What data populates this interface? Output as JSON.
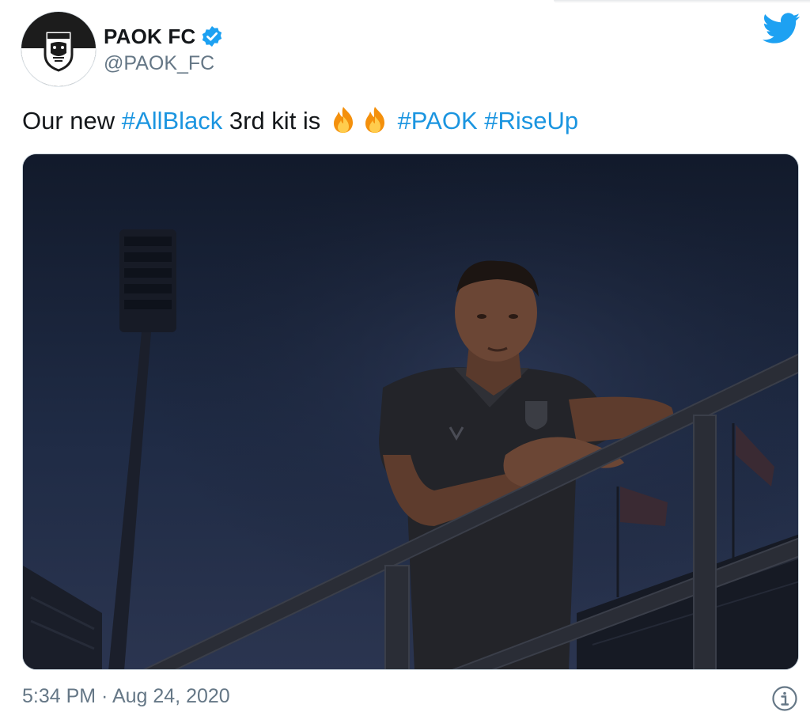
{
  "account": {
    "display_name": "PAOK FC",
    "handle": "@PAOK_FC",
    "verified": true,
    "avatar_icon": "paok-crest-icon"
  },
  "tweet": {
    "text_parts": [
      "Our new ",
      "#AllBlack",
      " 3rd kit is ",
      "#PAOK",
      "#RiseUp"
    ],
    "emojis": [
      "fire-emoji",
      "fire-emoji"
    ],
    "timestamp": "5:34 PM · Aug 24, 2020"
  },
  "media": {
    "image_icon": "player-photo-image"
  },
  "icons": {
    "brand": "twitter-bird-icon",
    "info": "info-icon"
  },
  "colors": {
    "hashtag": "#1b95e0",
    "verified": "#1da1f2",
    "twitter_brand": "#1da1f2",
    "text": "#14171a",
    "muted": "#657786"
  }
}
